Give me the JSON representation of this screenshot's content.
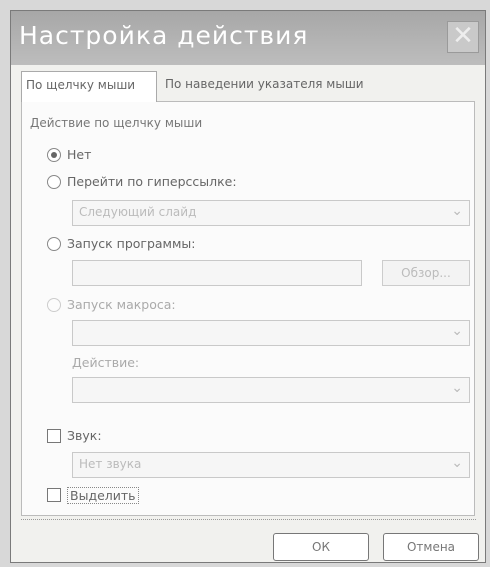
{
  "window": {
    "title": "Настройка действия"
  },
  "tabs": [
    {
      "label": "По щелчку мыши",
      "active": true
    },
    {
      "label": "По наведении указателя мыши",
      "active": false
    }
  ],
  "group": {
    "label": "Действие по щелчку мыши"
  },
  "options": {
    "none": "Нет",
    "hyperlink": "Перейти по гиперссылке:",
    "hyperlink_value": "Следующий слайд",
    "run_program": "Запуск программы:",
    "run_program_value": "",
    "browse_button": "Обзор...",
    "run_macro": "Запуск макроса:",
    "macro_value": "",
    "object_action": "Действие:",
    "object_action_value": ""
  },
  "sound": {
    "label": "Звук:",
    "value": "Нет звука"
  },
  "highlight": {
    "label": "Выделить"
  },
  "buttons": {
    "ok": "ОК",
    "cancel": "Отмена"
  }
}
